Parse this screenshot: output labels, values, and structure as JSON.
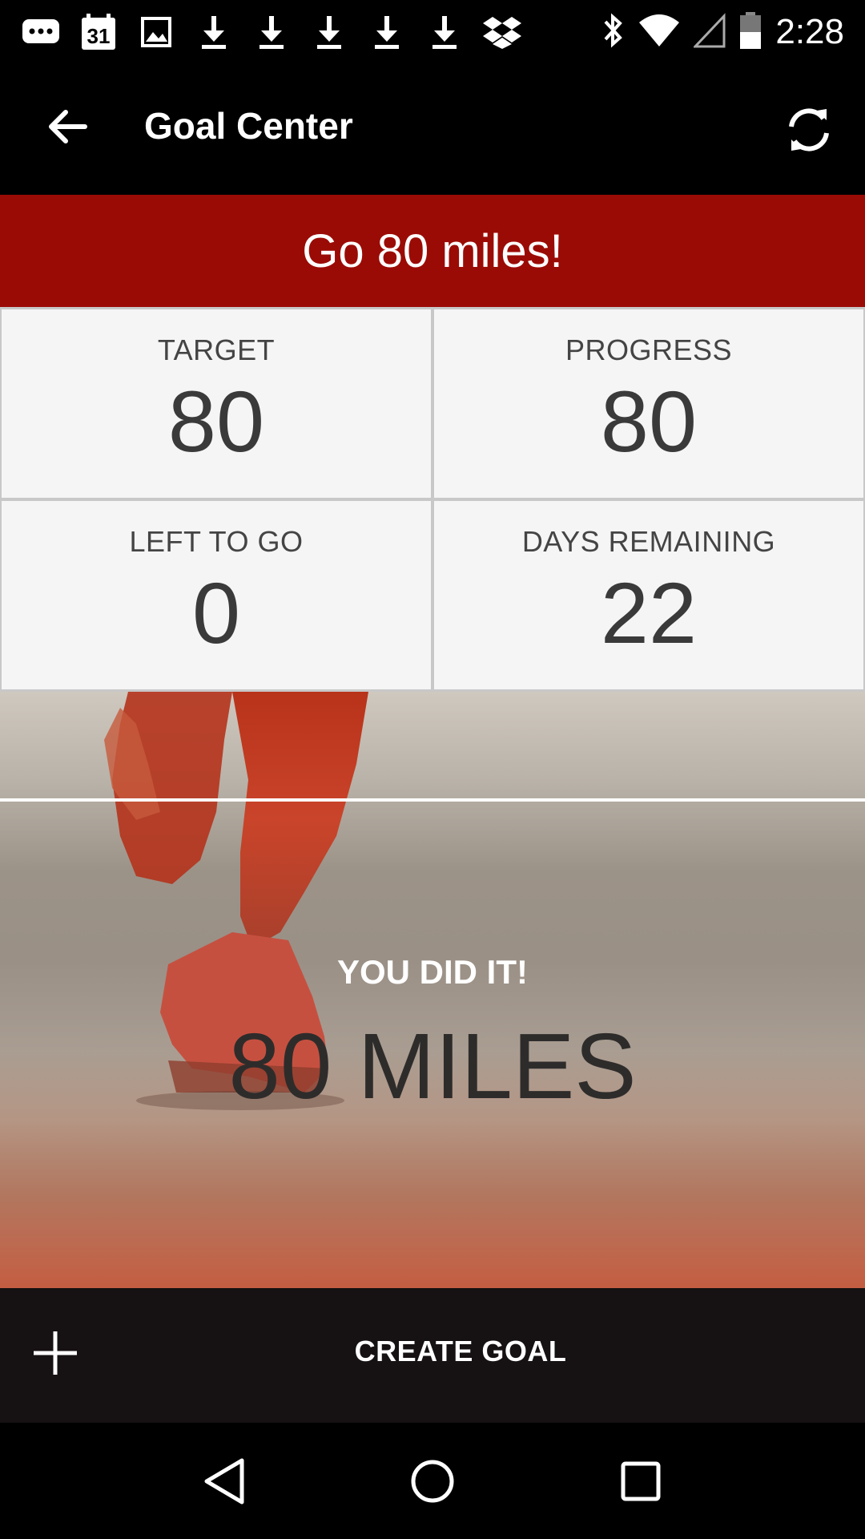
{
  "status_bar": {
    "time": "2:28",
    "calendar_day": "31",
    "left_icons": [
      "chat-bubble-icon",
      "calendar-icon",
      "image-icon",
      "download-icon",
      "download-icon",
      "download-icon",
      "download-icon",
      "download-icon",
      "dropbox-icon"
    ],
    "right_icons": [
      "bluetooth-icon",
      "wifi-icon",
      "cellular-signal-icon",
      "battery-icon"
    ]
  },
  "app_bar": {
    "title": "Goal Center",
    "back_icon": "arrow-left-icon",
    "refresh_icon": "refresh-icon"
  },
  "goal": {
    "banner": "Go 80 miles!"
  },
  "stats": [
    {
      "label": "TARGET",
      "value": "80"
    },
    {
      "label": "PROGRESS",
      "value": "80"
    },
    {
      "label": "LEFT TO GO",
      "value": "0"
    },
    {
      "label": "DAYS REMAINING",
      "value": "22"
    }
  ],
  "hero": {
    "kicker": "YOU DID IT!",
    "total": "80 MILES"
  },
  "create_goal": {
    "label": "CREATE GOAL",
    "icon": "plus-icon"
  },
  "nav_bar": {
    "icons": [
      "back-triangle-icon",
      "home-circle-icon",
      "recents-square-icon"
    ]
  },
  "colors": {
    "banner": "#9b0b05",
    "card_bg": "#f5f5f5",
    "create_bar": "#161112"
  }
}
